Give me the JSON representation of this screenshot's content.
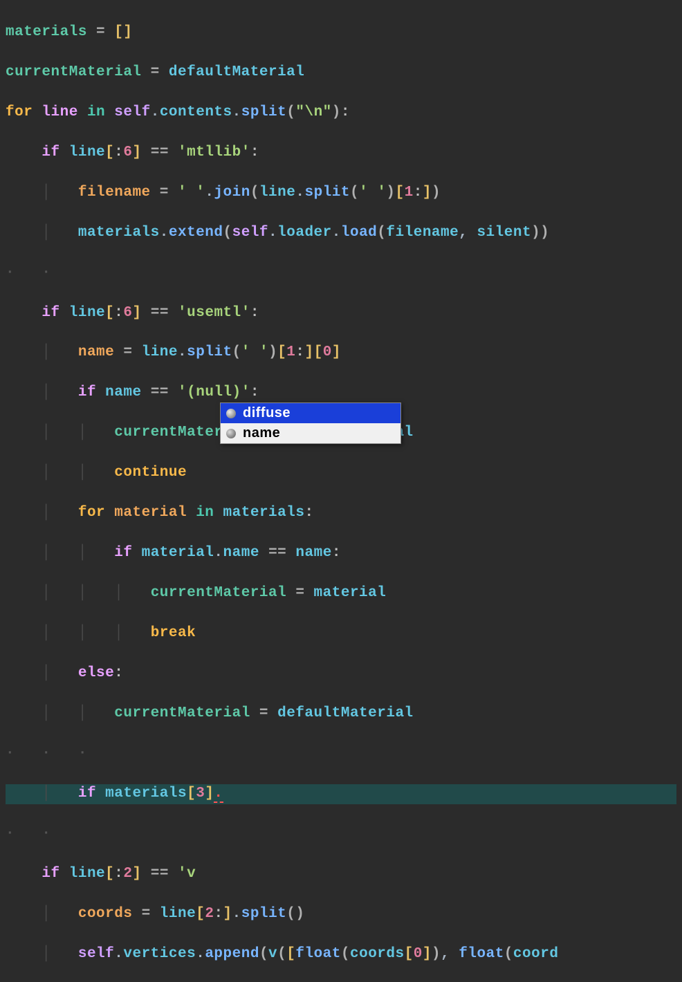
{
  "code": {
    "l1": {
      "materials": "materials",
      "eq": "=",
      "br_open": "[",
      "br_close": "]"
    },
    "l2": {
      "currentMaterial": "currentMaterial",
      "eq": "=",
      "defaultMaterial": "defaultMaterial"
    },
    "l3": {
      "for": "for",
      "line": "line",
      "in": "in",
      "self": "self",
      "contents": "contents",
      "split": "split",
      "arg": "\"\\n\""
    },
    "l4": {
      "if": "if",
      "line": "line",
      "six": "6",
      "eq": "==",
      "str": "'mtllib'"
    },
    "l5": {
      "filename": "filename",
      "eq": "=",
      "space": "' '",
      "join": "join",
      "line": "line",
      "split": "split",
      "sp2": "' '",
      "one": "1"
    },
    "l6": {
      "materials": "materials",
      "extend": "extend",
      "self": "self",
      "loader": "loader",
      "load": "load",
      "filename": "filename",
      "silent": "silent"
    },
    "l8": {
      "if": "if",
      "line": "line",
      "six": "6",
      "eq": "==",
      "str": "'usemtl'"
    },
    "l9": {
      "name": "name",
      "eq": "=",
      "line": "line",
      "split": "split",
      "sp": "' '",
      "one": "1",
      "zero": "0"
    },
    "l10": {
      "if": "if",
      "name": "name",
      "eq": "==",
      "str": "'(null)'"
    },
    "l11": {
      "currentMaterial": "currentMaterial",
      "eq": "=",
      "defaultMaterial": "defaultMaterial"
    },
    "l12": {
      "continue": "continue"
    },
    "l13": {
      "for": "for",
      "material": "material",
      "in": "in",
      "materials": "materials"
    },
    "l14": {
      "if": "if",
      "material": "material",
      "name": "name",
      "eq": "==",
      "name2": "name"
    },
    "l15": {
      "currentMaterial": "currentMaterial",
      "eq": "=",
      "material": "material"
    },
    "l16": {
      "break": "break"
    },
    "l17": {
      "else": "else"
    },
    "l18": {
      "currentMaterial": "currentMaterial",
      "eq": "=",
      "defaultMaterial": "defaultMaterial"
    },
    "l20": {
      "if": "if",
      "materials": "materials",
      "three": "3"
    },
    "l22": {
      "if": "if",
      "line": "line",
      "two": "2",
      "eq": "==",
      "str": "'v"
    },
    "l23": {
      "coords": "coords",
      "eq": "=",
      "line": "line",
      "two": "2",
      "split": "split"
    },
    "l24": {
      "self": "self",
      "vertices": "vertices",
      "append": "append",
      "v": "v",
      "float": "float",
      "coords": "coords",
      "zero": "0",
      "float2": "float",
      "coord2": "coord"
    }
  },
  "completion": {
    "items": [
      {
        "label": "diffuse",
        "selected": true
      },
      {
        "label": "name",
        "selected": false
      }
    ]
  }
}
